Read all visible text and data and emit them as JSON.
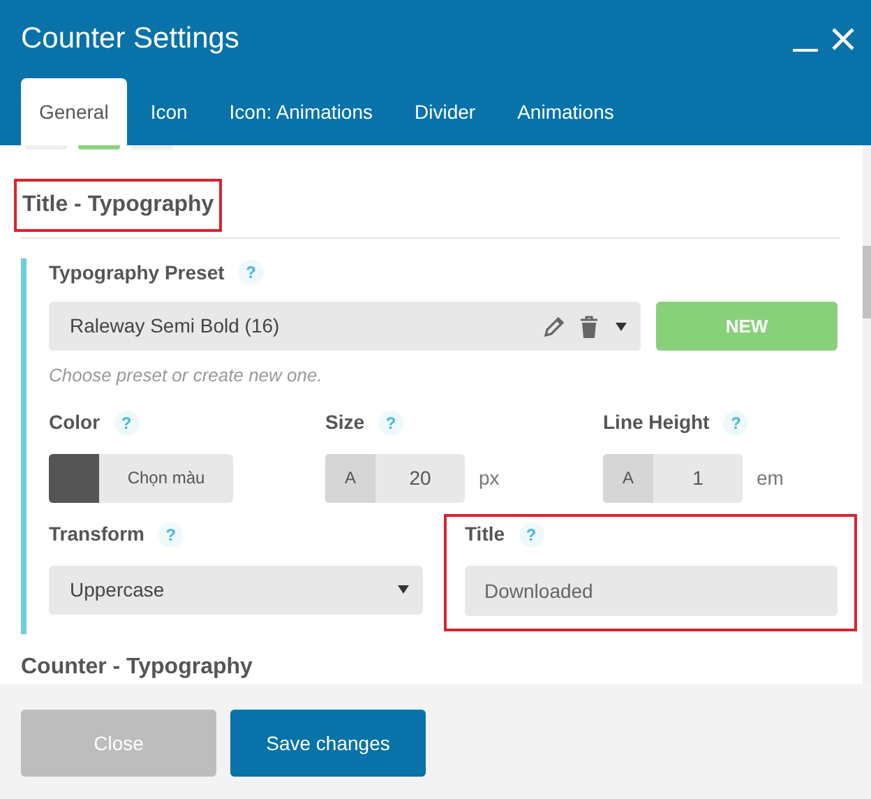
{
  "window": {
    "title": "Counter Settings"
  },
  "tabs": [
    {
      "label": "General",
      "selected": true
    },
    {
      "label": "Icon",
      "selected": false
    },
    {
      "label": "Icon: Animations",
      "selected": false
    },
    {
      "label": "Divider",
      "selected": false
    },
    {
      "label": "Animations",
      "selected": false
    }
  ],
  "section": {
    "heading": "Title - Typography",
    "highlighted": true
  },
  "preset": {
    "label": "Typography Preset",
    "help": "?",
    "value": "Raleway Semi Bold (16)",
    "new_button": "NEW",
    "hint": "Choose preset or create new one."
  },
  "color": {
    "label": "Color",
    "help": "?",
    "button": "Chọn màu"
  },
  "size": {
    "label": "Size",
    "help": "?",
    "prefix": "A",
    "value": "20",
    "unit": "px"
  },
  "line_height": {
    "label": "Line Height",
    "help": "?",
    "prefix": "A",
    "value": "1",
    "unit": "em"
  },
  "transform": {
    "label": "Transform",
    "help": "?",
    "value": "Uppercase"
  },
  "title_field": {
    "label": "Title",
    "help": "?",
    "value": "Downloaded",
    "highlighted": true
  },
  "next_section": {
    "heading": "Counter - Typography"
  },
  "buttons": [
    {
      "label": "Close",
      "kind": "secondary"
    },
    {
      "label": "Save changes",
      "kind": "primary"
    }
  ]
}
